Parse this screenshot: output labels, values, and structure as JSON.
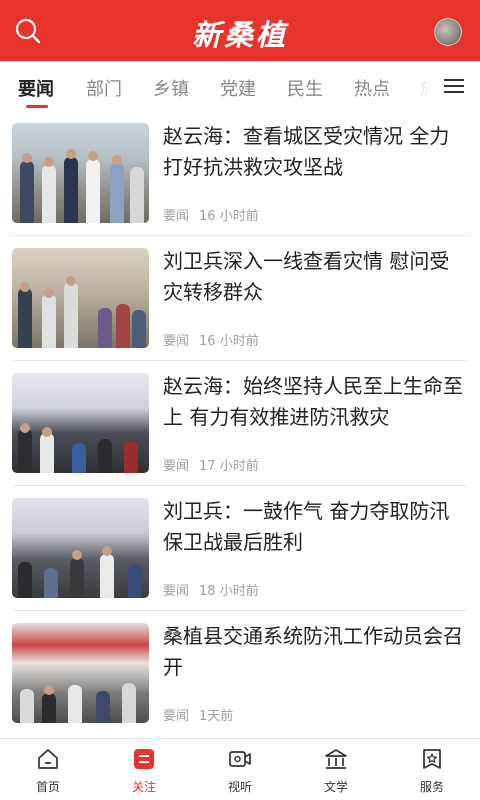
{
  "header": {
    "logo_text": "新桑植",
    "search_icon": "search-icon",
    "avatar_icon": "avatar"
  },
  "tabs": [
    {
      "label": "要闻",
      "active": true
    },
    {
      "label": "部门"
    },
    {
      "label": "乡镇"
    },
    {
      "label": "党建"
    },
    {
      "label": "民生"
    },
    {
      "label": "热点"
    },
    {
      "label": "旅"
    }
  ],
  "menu_icon": "menu-icon",
  "articles": [
    {
      "title": "赵云海：查看城区受灾情况 全力打好抗洪救灾攻坚战",
      "category": "要闻",
      "time": "16 小时前"
    },
    {
      "title": "刘卫兵深入一线查看灾情 慰问受灾转移群众",
      "category": "要闻",
      "time": "16 小时前"
    },
    {
      "title": "赵云海：始终坚持人民至上生命至上 有力有效推进防汛救灾",
      "category": "要闻",
      "time": "17 小时前"
    },
    {
      "title": "刘卫兵：一鼓作气 奋力夺取防汛保卫战最后胜利",
      "category": "要闻",
      "time": "18 小时前"
    },
    {
      "title": "桑植县交通系统防汛工作动员会召开",
      "category": "要闻",
      "time": "1天前"
    }
  ],
  "bottom_nav": [
    {
      "label": "首页",
      "icon": "home-icon"
    },
    {
      "label": "关注",
      "icon": "follow-icon",
      "active": true
    },
    {
      "label": "视听",
      "icon": "video-icon"
    },
    {
      "label": "文学",
      "icon": "literature-icon"
    },
    {
      "label": "服务",
      "icon": "service-icon"
    }
  ],
  "colors": {
    "brand": "#e8322c",
    "text": "#222222",
    "muted": "#a0a0a0"
  }
}
